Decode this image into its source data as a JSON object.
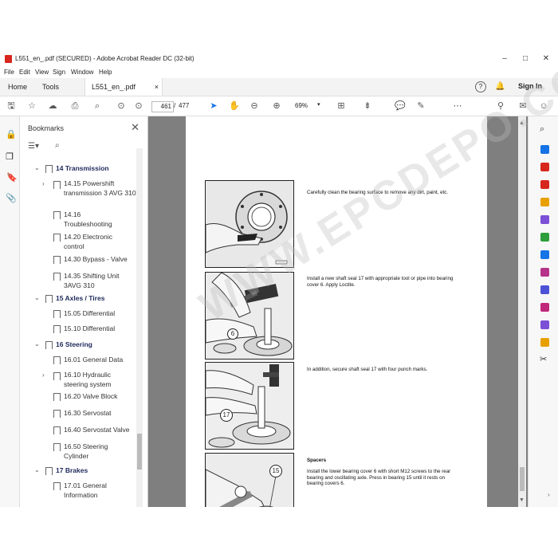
{
  "window": {
    "title": "L551_en_.pdf (SECURED) - Adobe Acrobat Reader DC (32-bit)",
    "minimize": "–",
    "maximize": "□",
    "close": "✕"
  },
  "menu": [
    "File",
    "Edit",
    "View",
    "Sign",
    "Window",
    "Help"
  ],
  "tabs": {
    "home": "Home",
    "tools": "Tools",
    "doc": "L551_en_.pdf (SEC...",
    "doc_close": "×",
    "help": "?",
    "sign_in": "Sign In"
  },
  "toolbar": {
    "page_current": "461",
    "page_sep": "/",
    "page_total": "477",
    "zoom": "69%"
  },
  "bookmarks": {
    "title": "Bookmarks",
    "close": "✕",
    "items": [
      {
        "label": "14  Transmission",
        "level": 0
      },
      {
        "label": "14.15  Powershift transmission 3 AVG 310",
        "level": 1
      },
      {
        "label": "14.16 Troubleshooting",
        "level": 1
      },
      {
        "label": "14.20  Electronic control",
        "level": 1
      },
      {
        "label": "14.30  Bypass - Valve",
        "level": 1
      },
      {
        "label": "14.35  Shifting Unit 3AVG 310",
        "level": 1
      },
      {
        "label": "15  Axles / Tires",
        "level": 0
      },
      {
        "label": "15.05  Differential",
        "level": 1
      },
      {
        "label": "15.10  Differential",
        "level": 1
      },
      {
        "label": "16  Steering",
        "level": 0
      },
      {
        "label": "16.01  General Data",
        "level": 1
      },
      {
        "label": "16.10  Hydraulic steering system",
        "level": 1
      },
      {
        "label": "16.20  Valve Block",
        "level": 1
      },
      {
        "label": "16.30  Servostat",
        "level": 1
      },
      {
        "label": "16.40  Servostat Valve",
        "level": 1
      },
      {
        "label": "16.50  Steering Cylinder",
        "level": 1
      },
      {
        "label": "17  Brakes",
        "level": 0
      },
      {
        "label": "17.01  General Information",
        "level": 1
      }
    ]
  },
  "page": {
    "step1": "Carefully clean the bearing surface to remove any dirt, paint, etc.",
    "step2": "Install a new shaft seal 17 with appropriate tool or pipe into bearing cover 6.  Apply Loctite.",
    "step3": "In addition, secure shaft seal 17 with four punch marks.",
    "section": "Spacers",
    "step4": "Install the lower bearing cover 6 with short M12 screws to the rear bearing and oscillating axle.  Press in bearing 15 until it rests on bearing covers 6.",
    "callout_6": "6",
    "callout_17": "17",
    "callout_15": "15",
    "watermark": "WWW.EPCDEPO.COM"
  },
  "colors": {
    "acrobat_red": "#d7261e",
    "bookmark_header": "#1d2a5a",
    "accent_blue": "#1473e6"
  }
}
